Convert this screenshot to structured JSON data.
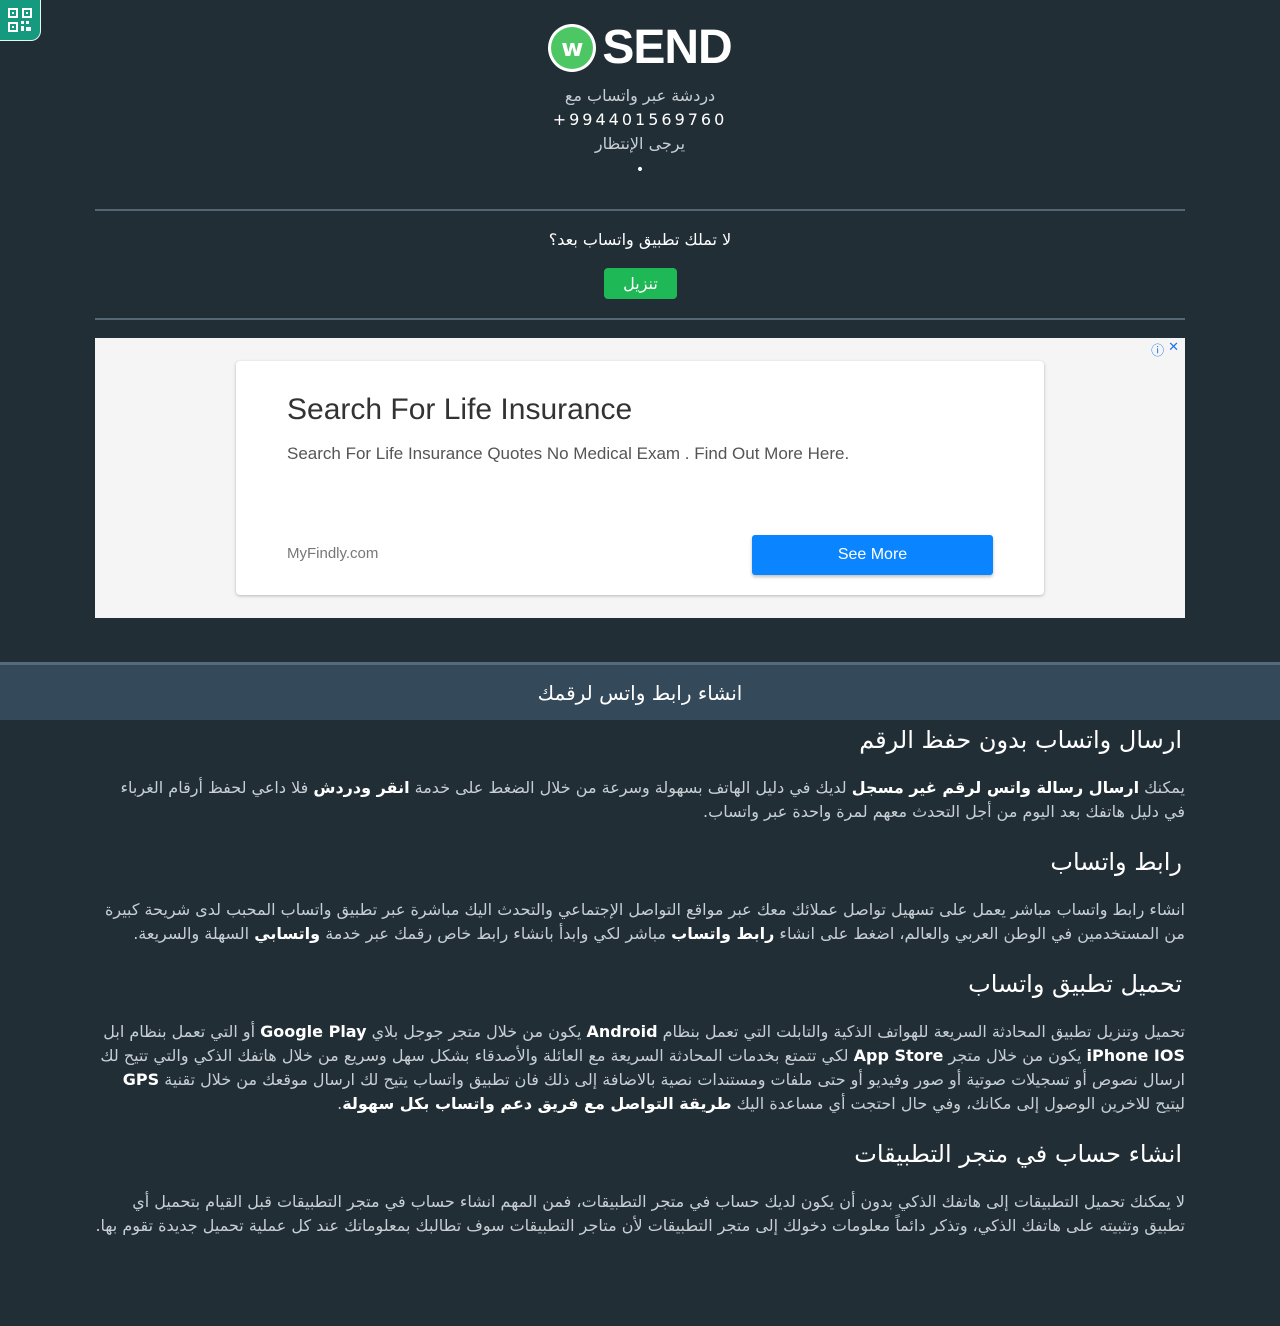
{
  "logo": {
    "badge_letter": "w",
    "text": "SEND"
  },
  "header": {
    "chat_line": "دردشة عبر واتساب مع",
    "phone": "+994401569760",
    "wait_text": "يرجى الإنتظار",
    "dot": "•"
  },
  "download": {
    "question": "لا تملك تطبيق واتساب بعد؟",
    "button": "تنزيل"
  },
  "ad": {
    "info_icon": "ⓘ",
    "close_icon": "✕",
    "title": "Search For Life Insurance",
    "description": "Search For Life Insurance Quotes No Medical Exam . Find Out More Here.",
    "site": "MyFindly.com",
    "button": "See More"
  },
  "band": {
    "title": "انشاء رابط واتس لرقمك"
  },
  "sections": [
    {
      "heading": "ارسال واتساب بدون حفظ الرقم",
      "p": [
        "يمكنك ",
        "ارسال رسالة واتس لرقم غير مسجل",
        " لديك في دليل الهاتف بسهولة وسرعة من خلال الضغط على خدمة ",
        "انقر ودردش",
        " فلا داعي لحفظ أرقام الغرباء في دليل هاتفك بعد اليوم من أجل التحدث معهم لمرة واحدة عبر واتساب."
      ]
    },
    {
      "heading": "رابط واتساب",
      "p": [
        "انشاء رابط واتساب مباشر يعمل على تسهيل تواصل عملائك معك عبر مواقع التواصل الإجتماعي والتحدث اليك مباشرة عبر تطبيق واتساب المحبب لدى شريحة كبيرة من المستخدمين في الوطن العربي والعالم، اضغط على انشاء ",
        "رابط واتساب",
        " مباشر لكي وابدأ بانشاء رابط خاص رقمك عبر خدمة ",
        "واتسابي",
        " السهلة والسريعة."
      ]
    },
    {
      "heading": "تحميل تطبيق واتساب",
      "p": [
        "تحميل وتنزيل تطبيق المحادثة السريعة للهواتف الذكية والتابلت التي تعمل بنظام ",
        "Android",
        " يكون من خلال متجر جوجل بلاي ",
        "Google Play",
        " أو التي تعمل بنظام ابل ",
        "iPhone IOS",
        " يكون من خلال متجر ",
        "App Store",
        " لكي تتمتع بخدمات المحادثة السريعة مع العائلة والأصدقاء بشكل سهل وسريع من خلال هاتفك الذكي والتي تتيح لك ارسال نصوص أو تسجيلات صوتية أو صور وفيديو أو حتى ملفات ومستندات نصية بالاضافة إلى ذلك فان تطبيق واتساب يتيح لك ارسال موقعك من خلال تقنية ",
        "GPS",
        " ليتيح للاخرين الوصول إلى مكانك، وفي حال احتجت أي مساعدة اليك ",
        "طريقة التواصل مع فريق دعم واتساب بكل سهولة",
        "."
      ]
    },
    {
      "heading": "انشاء حساب في متجر التطبيقات",
      "p": [
        "لا يمكنك تحميل التطبيقات إلى هاتفك الذكي بدون أن يكون لديك حساب في متجر التطبيقات، فمن المهم انشاء حساب في متجر التطبيقات قبل القيام بتحميل أي تطبيق وتثبيته على هاتفك الذكي، وتذكر دائماً معلومات دخولك إلى متجر التطبيقات لأن متاجر التطبيقات سوف تطالبك بمعلوماتك عند كل عملية تحميل جديدة تقوم بها."
      ]
    }
  ]
}
